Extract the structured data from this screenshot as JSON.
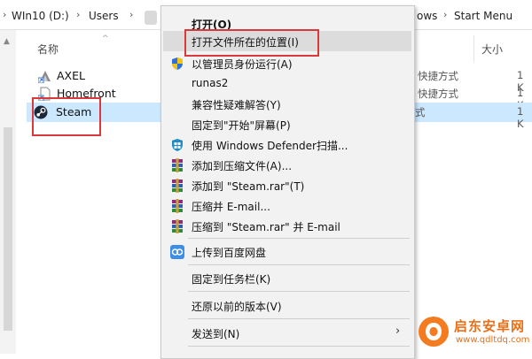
{
  "address_bar": {
    "crumbs": [
      "WIn10 (D:)",
      "Users",
      "ows",
      "Start Menu"
    ]
  },
  "file_pane": {
    "column_name": "名称",
    "column_size": "大小",
    "files": [
      {
        "name": "AXEL",
        "type": "快捷方式",
        "size": "1 K",
        "icon": "axel-shortcut-icon"
      },
      {
        "name": "Homefront",
        "type": "快捷方式",
        "size": "1 K",
        "icon": "file-shortcut-icon"
      },
      {
        "name": "Steam",
        "type": "式",
        "size": "1 K",
        "icon": "steam-icon",
        "selected": true
      }
    ]
  },
  "context_menu": {
    "items": [
      {
        "label": "打开(O)",
        "bold": true,
        "icon": ""
      },
      {
        "label": "打开文件所在的位置(I)",
        "icon": "",
        "hover": true
      },
      {
        "label": "以管理员身份运行(A)",
        "icon": "uac-shield-icon"
      },
      {
        "label": "runas2",
        "icon": ""
      },
      {
        "label": "兼容性疑难解答(Y)",
        "icon": ""
      },
      {
        "label": "固定到\"开始\"屏幕(P)",
        "icon": ""
      },
      {
        "label": "使用 Windows Defender扫描...",
        "icon": "windows-defender-icon"
      },
      {
        "label": "添加到压缩文件(A)...",
        "icon": "winrar-icon"
      },
      {
        "label": "添加到 \"Steam.rar\"(T)",
        "icon": "winrar-icon"
      },
      {
        "label": "压缩并 E-mail...",
        "icon": "winrar-icon"
      },
      {
        "label": "压缩到 \"Steam.rar\" 并 E-mail",
        "icon": "winrar-icon"
      },
      {
        "label": "上传到百度网盘",
        "icon": "baidu-netdisk-icon"
      },
      {
        "label": "固定到任务栏(K)",
        "icon": ""
      },
      {
        "label": "还原以前的版本(V)",
        "icon": ""
      },
      {
        "label": "发送到(N)",
        "icon": "",
        "submenu": true
      }
    ]
  },
  "watermark": {
    "title": "启东安卓网",
    "url": "www.qdltdq.com"
  },
  "colors": {
    "selection": "#cce8ff",
    "highlight_border": "#d9393a",
    "menu_background": "#f2f2f2",
    "menu_hover": "#dcdcdc",
    "watermark": "#e8701a"
  }
}
